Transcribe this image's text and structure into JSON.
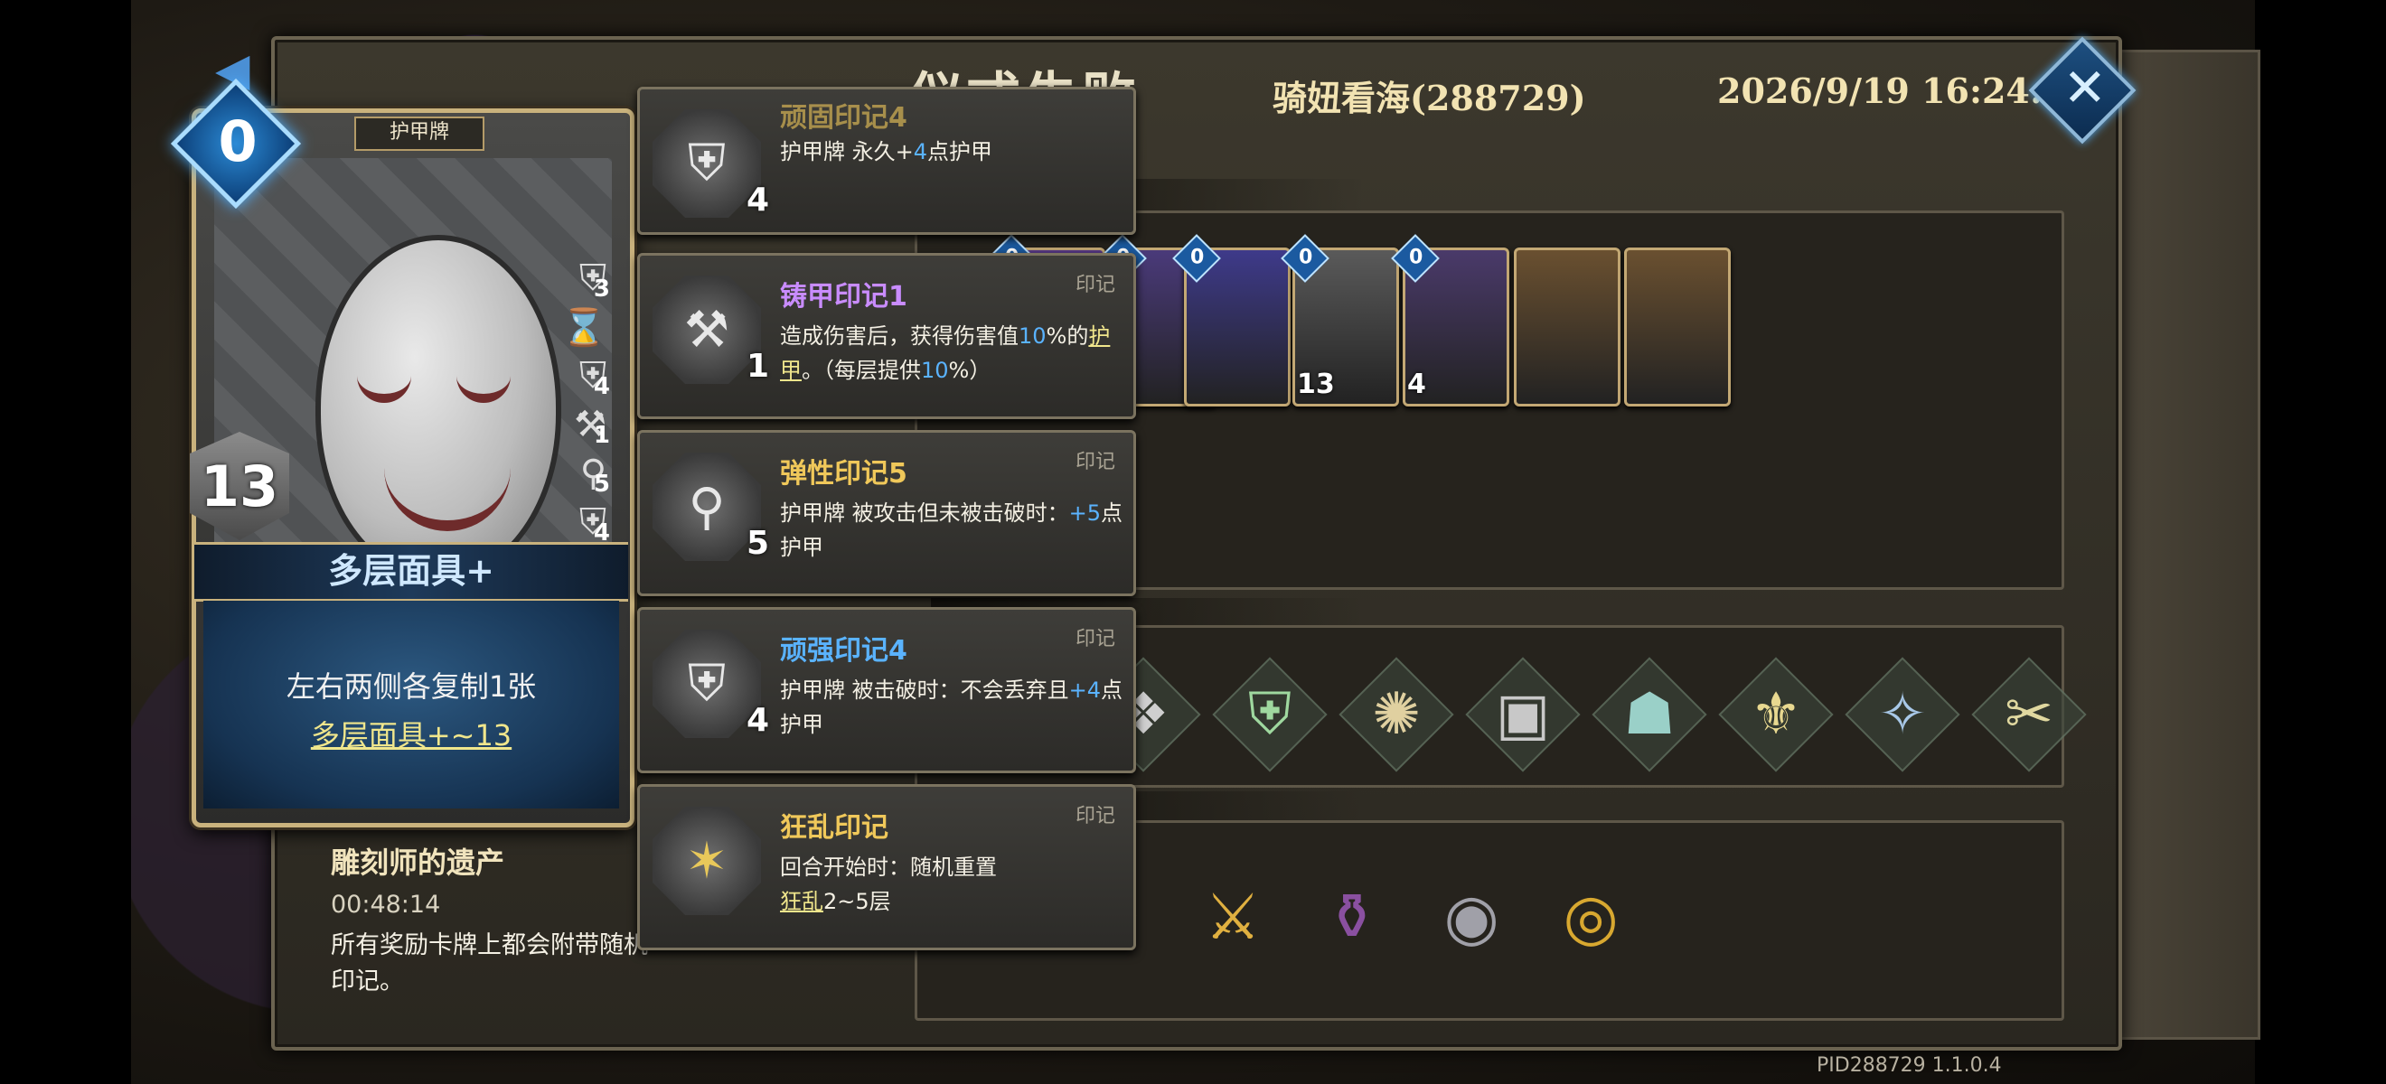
{
  "header": {
    "title": "仪式失败",
    "player": "骑妞看海(288729)",
    "datetime": "2026/9/19 16:24:46",
    "close_icon": "close-icon"
  },
  "card": {
    "type_label": "护甲牌",
    "cost": "0",
    "armor": "13",
    "name": "多层面具+",
    "desc_line1": "左右两侧各复制1张",
    "desc_link": "多层面具+~13",
    "stacks": [
      "3",
      "4",
      "1",
      "5",
      "4"
    ]
  },
  "relic_info": {
    "name": "雕刻师的遗产",
    "time": "00:48:14",
    "desc": "所有奖励卡牌上都会附带随机印记。"
  },
  "tooltips": [
    {
      "name": "顽固印记4",
      "stack": "4",
      "desc_a": "护甲牌 永久+",
      "desc_num": "4",
      "desc_b": "点护甲",
      "color": "#f0c85a"
    },
    {
      "name": "铸甲印记1",
      "stack": "1",
      "tag": "印记",
      "desc_a": "造成伤害后，获得伤害值",
      "desc_num": "10",
      "desc_b": "%的",
      "desc_link": "护甲",
      "desc_c": "。（每层提供",
      "desc_num2": "10",
      "desc_d": "%）",
      "color": "#c98cff"
    },
    {
      "name": "弹性印记5",
      "stack": "5",
      "tag": "印记",
      "desc_a": "护甲牌 被攻击但未被击破时：",
      "desc_num": "+5",
      "desc_b": "点护甲",
      "color": "#f0c85a"
    },
    {
      "name": "顽强印记4",
      "stack": "4",
      "tag": "印记",
      "desc_a": "护甲牌 被击破时：不会丢弃且",
      "desc_num": "+4",
      "desc_b": "点护甲",
      "color": "#5ab3ff"
    },
    {
      "name": "狂乱印记",
      "tag": "印记",
      "desc_a": "回合开始时：随机重置",
      "desc_link": "狂乱",
      "desc_b": "2~5层",
      "color": "#f0c85a"
    }
  ],
  "deck_cards": [
    {
      "cost": "0",
      "dmg": "",
      "color": "#5a3a8a"
    },
    {
      "cost": "0",
      "dmg": "",
      "color": "#4a3a7a"
    },
    {
      "cost": "0",
      "dmg": "",
      "color": "#3e3a8a"
    },
    {
      "cost": "0",
      "dmg": "13",
      "color": "#5a5a5a"
    },
    {
      "cost": "0",
      "dmg": "4",
      "color": "#4a3a6a"
    },
    {
      "cost": "",
      "dmg": "",
      "color": "#6a5030"
    },
    {
      "cost": "",
      "dmg": "",
      "color": "#6a5030"
    }
  ],
  "relics": [
    "❖",
    "⛨",
    "✺",
    "▣",
    "☗",
    "⚜",
    "✧",
    "✂"
  ],
  "items": [
    "✴",
    "✴",
    "⚔",
    "⚱",
    "◉",
    "◎"
  ],
  "footer": {
    "pid": "PID288729  1.1.0.4"
  }
}
